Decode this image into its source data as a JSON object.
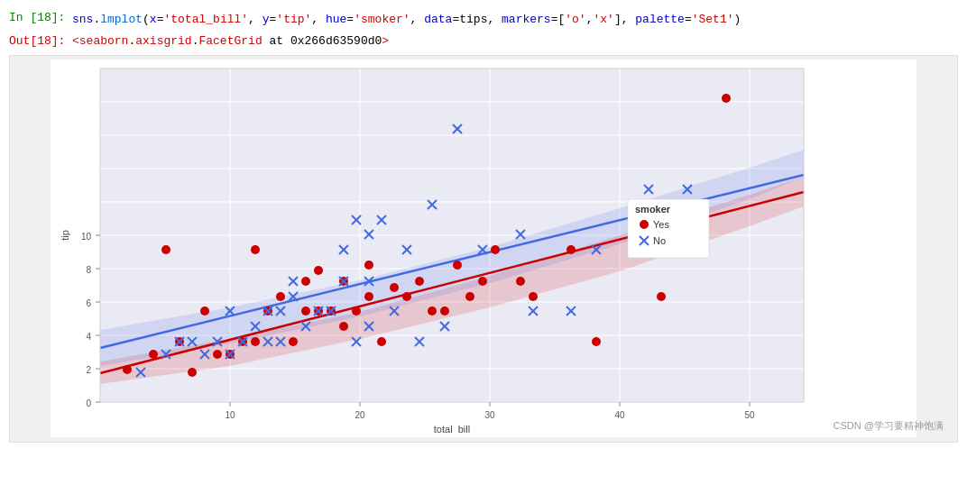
{
  "cell_input": {
    "label": "In  [18]:",
    "code_prefix": "sns.lmplot(",
    "code_x": "x='total_bill'",
    "code_y": "y='tip'",
    "code_hue": "hue='smoker'",
    "code_data": "data=tips",
    "code_markers": "markers=['o','x']",
    "code_palette": "palette='Set1')",
    "full_code": "sns.lmplot(x='total_bill', y='tip', hue='smoker', data=tips, markers=['o','x'], palette='Set1')"
  },
  "cell_output": {
    "label": "Out[18]:",
    "text": "<seaborn.axisgrid.FacetGrid at 0x266d63590d0>"
  },
  "plot": {
    "x_label": "total_bill",
    "y_label": "tip",
    "x_ticks": [
      "10",
      "20",
      "30",
      "40",
      "50"
    ],
    "y_ticks": [
      "2",
      "4",
      "6",
      "8",
      "10"
    ],
    "legend_title": "smoker",
    "legend_yes": "Yes",
    "legend_no": "No",
    "color_yes": "#cc0000",
    "color_no": "#4169e1"
  },
  "watermark": "CSDN @学习要精神饱满"
}
